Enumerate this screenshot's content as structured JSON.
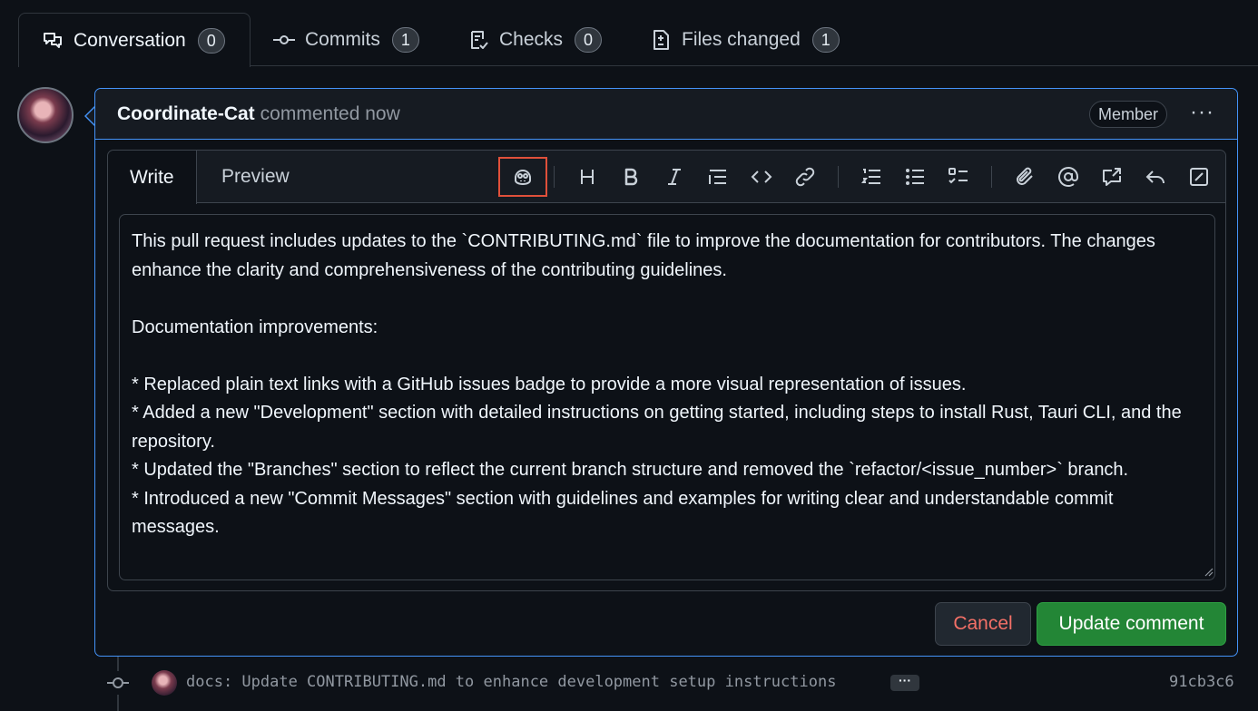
{
  "tabs": [
    {
      "label": "Conversation",
      "count": "0",
      "icon": "comment-discussion-icon"
    },
    {
      "label": "Commits",
      "count": "1",
      "icon": "git-commit-icon"
    },
    {
      "label": "Checks",
      "count": "0",
      "icon": "checklist-icon"
    },
    {
      "label": "Files changed",
      "count": "1",
      "icon": "file-diff-icon"
    }
  ],
  "comment": {
    "author": "Coordinate-Cat",
    "action": "commented now",
    "role_badge": "Member",
    "menu_glyph": "···"
  },
  "editor": {
    "tabs": {
      "write": "Write",
      "preview": "Preview"
    },
    "toolbar": [
      "copilot-icon",
      "heading-icon",
      "bold-icon",
      "italic-icon",
      "quote-icon",
      "code-icon",
      "link-icon",
      "ordered-list-icon",
      "unordered-list-icon",
      "task-list-icon",
      "attach-icon",
      "mention-icon",
      "reference-icon",
      "undo-icon",
      "fullscreen-icon"
    ],
    "text": "This pull request includes updates to the `CONTRIBUTING.md` file to improve the documentation for contributors. The changes enhance the clarity and comprehensiveness of the contributing guidelines.\n\nDocumentation improvements:\n\n* Replaced plain text links with a GitHub issues badge to provide a more visual representation of issues.\n* Added a new \"Development\" section with detailed instructions on getting started, including steps to install Rust, Tauri CLI, and the repository.\n* Updated the \"Branches\" section to reflect the current branch structure and removed the `refactor/<issue_number>` branch.\n* Introduced a new \"Commit Messages\" section with guidelines and examples for writing clear and understandable commit messages.",
    "cancel_label": "Cancel",
    "update_label": "Update comment"
  },
  "commit": {
    "message": "docs: Update CONTRIBUTING.md to enhance development setup instructions",
    "ellipsis_label": "···",
    "sha": "91cb3c6"
  },
  "colors": {
    "accent": "#4493f8",
    "primary_button": "#238636",
    "danger_text": "#f47067",
    "highlight_box": "#e0503a"
  }
}
